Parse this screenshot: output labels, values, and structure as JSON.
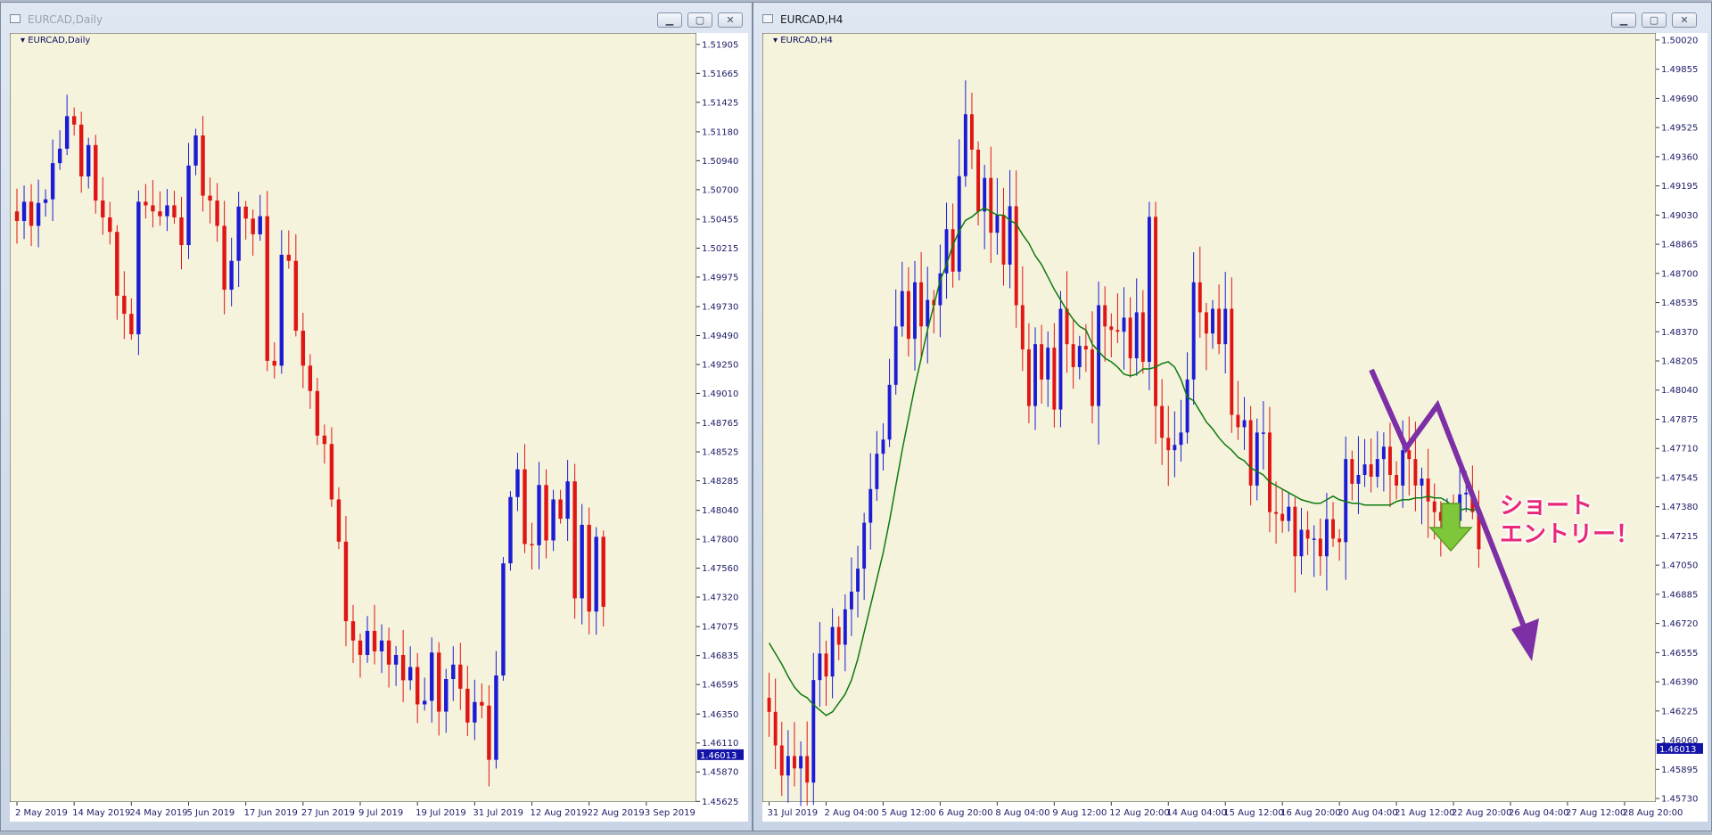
{
  "windows": {
    "left": {
      "title": "EURCAD,Daily",
      "minimize": "▁",
      "maximize": "▢",
      "close": "✕"
    },
    "right": {
      "title": "EURCAD,H4",
      "minimize": "▁",
      "maximize": "▢",
      "close": "✕"
    }
  },
  "colors": {
    "background": "#f5f3dc",
    "bull": "#1c1cd6",
    "bear": "#e01515",
    "ma": "#0e7a0e",
    "axis_text": "#1a1a66",
    "price_badge": "#1414a8",
    "arrow": "#7d2fa6",
    "entry_arrow": "#7ec63a",
    "annotation": "#e8267a"
  },
  "annotation": {
    "line1": "ショート",
    "line2": "エントリー！"
  },
  "chart_data": [
    {
      "name": "EURCAD,Daily",
      "type": "candlestick",
      "symbol_label": "EURCAD,Daily",
      "current_price": "1.46013",
      "ylim": [
        1.4562,
        1.52
      ],
      "y_ticks": [
        "1.51905",
        "1.51665",
        "1.51425",
        "1.51180",
        "1.50940",
        "1.50700",
        "1.50455",
        "1.50215",
        "1.49975",
        "1.49730",
        "1.49490",
        "1.49250",
        "1.49010",
        "1.48765",
        "1.48525",
        "1.48285",
        "1.48040",
        "1.47800",
        "1.47560",
        "1.47320",
        "1.47075",
        "1.46835",
        "1.46595",
        "1.46350",
        "1.46110",
        "1.45870",
        "1.45625"
      ],
      "x_labels": [
        {
          "label": "2 May 2019",
          "i": 0
        },
        {
          "label": "14 May 2019",
          "i": 8
        },
        {
          "label": "24 May 2019",
          "i": 16
        },
        {
          "label": "5 Jun 2019",
          "i": 24
        },
        {
          "label": "17 Jun 2019",
          "i": 32
        },
        {
          "label": "27 Jun 2019",
          "i": 40
        },
        {
          "label": "9 Jul 2019",
          "i": 48
        },
        {
          "label": "19 Jul 2019",
          "i": 56
        },
        {
          "label": "31 Jul 2019",
          "i": 64
        },
        {
          "label": "12 Aug 2019",
          "i": 72
        },
        {
          "label": "22 Aug 2019",
          "i": 80
        },
        {
          "label": "3 Sep 2019",
          "i": 88
        }
      ],
      "slots": 96,
      "closes": [
        1.5044,
        1.506,
        1.504,
        1.5059,
        1.5062,
        1.5092,
        1.5104,
        1.5131,
        1.5124,
        1.5081,
        1.5107,
        1.5061,
        1.5047,
        1.5035,
        1.4982,
        1.4967,
        1.495,
        1.506,
        1.5057,
        1.5052,
        1.5048,
        1.5057,
        1.5047,
        1.5024,
        1.509,
        1.5115,
        1.5065,
        1.5061,
        1.504,
        1.4987,
        1.5011,
        1.5056,
        1.5046,
        1.5033,
        1.5048,
        1.4928,
        1.4924,
        1.5016,
        1.5011,
        1.4953,
        1.4924,
        1.4903,
        1.4866,
        1.4859,
        1.4813,
        1.4778,
        1.4712,
        1.4696,
        1.4684,
        1.4704,
        1.4687,
        1.4696,
        1.4676,
        1.4684,
        1.4663,
        1.4674,
        1.4643,
        1.4646,
        1.4686,
        1.4637,
        1.4664,
        1.4676,
        1.4656,
        1.4628,
        1.4645,
        1.4642,
        1.4597,
        1.4667,
        1.476,
        1.4815,
        1.4838,
        1.4776,
        1.4775,
        1.4825,
        1.4779,
        1.4813,
        1.4797,
        1.4828,
        1.4731,
        1.4792,
        1.472,
        1.4782,
        1.4724
      ]
    },
    {
      "name": "EURCAD,H4",
      "type": "candlestick",
      "symbol_label": "EURCAD,H4",
      "current_price": "1.46013",
      "ylim": [
        1.4571,
        1.5006
      ],
      "y_ticks": [
        "1.50020",
        "1.49855",
        "1.49690",
        "1.49525",
        "1.49360",
        "1.49195",
        "1.49030",
        "1.48865",
        "1.48700",
        "1.48535",
        "1.48370",
        "1.48205",
        "1.48040",
        "1.47875",
        "1.47710",
        "1.47545",
        "1.47380",
        "1.47215",
        "1.47050",
        "1.46885",
        "1.46720",
        "1.46555",
        "1.46390",
        "1.46225",
        "1.46060",
        "1.45895",
        "1.45730"
      ],
      "x_labels": [
        {
          "label": "31 Jul 2019",
          "i": 0
        },
        {
          "label": "2 Aug 04:00",
          "i": 9
        },
        {
          "label": "5 Aug 12:00",
          "i": 18
        },
        {
          "label": "6 Aug 20:00",
          "i": 27
        },
        {
          "label": "8 Aug 04:00",
          "i": 36
        },
        {
          "label": "9 Aug 12:00",
          "i": 45
        },
        {
          "label": "12 Aug 20:00",
          "i": 54
        },
        {
          "label": "14 Aug 04:00",
          "i": 63
        },
        {
          "label": "15 Aug 12:00",
          "i": 72
        },
        {
          "label": "16 Aug 20:00",
          "i": 81
        },
        {
          "label": "20 Aug 04:00",
          "i": 90
        },
        {
          "label": "21 Aug 12:00",
          "i": 99
        },
        {
          "label": "22 Aug 20:00",
          "i": 108
        },
        {
          "label": "26 Aug 04:00",
          "i": 117
        },
        {
          "label": "27 Aug 12:00",
          "i": 126
        },
        {
          "label": "28 Aug 20:00",
          "i": 135
        }
      ],
      "slots": 141,
      "closes": [
        1.4622,
        1.4603,
        1.4586,
        1.4597,
        1.459,
        1.4597,
        1.4582,
        1.464,
        1.4655,
        1.4642,
        1.467,
        1.466,
        1.468,
        1.469,
        1.4703,
        1.4729,
        1.4748,
        1.4768,
        1.4776,
        1.4807,
        1.484,
        1.486,
        1.4833,
        1.4865,
        1.484,
        1.4855,
        1.4852,
        1.487,
        1.4895,
        1.4871,
        1.4925,
        1.496,
        1.494,
        1.4905,
        1.4924,
        1.4893,
        1.4903,
        1.4875,
        1.4908,
        1.4852,
        1.4827,
        1.4795,
        1.483,
        1.481,
        1.4828,
        1.4793,
        1.485,
        1.483,
        1.4817,
        1.4829,
        1.4827,
        1.4795,
        1.4852,
        1.484,
        1.4838,
        1.4837,
        1.4845,
        1.4822,
        1.4848,
        1.482,
        1.4902,
        1.4795,
        1.4777,
        1.477,
        1.4773,
        1.478,
        1.481,
        1.4865,
        1.4848,
        1.4836,
        1.485,
        1.483,
        1.485,
        1.479,
        1.4783,
        1.4787,
        1.475,
        1.478,
        1.478,
        1.4735,
        1.4734,
        1.473,
        1.4738,
        1.471,
        1.4725,
        1.472,
        1.472,
        1.471,
        1.4731,
        1.472,
        1.4718,
        1.4765,
        1.4751,
        1.4756,
        1.4762,
        1.4755,
        1.4765,
        1.4772,
        1.4756,
        1.475,
        1.477,
        1.4765,
        1.475,
        1.4754,
        1.4741,
        1.4735,
        1.473,
        1.4737,
        1.473,
        1.4745,
        1.4746,
        1.4735,
        1.4714
      ],
      "ma_closes": [
        1.4661,
        1.4655,
        1.4649,
        1.4642,
        1.4636,
        1.4632,
        1.463,
        1.4626,
        1.4623,
        1.462,
        1.4622,
        1.4627,
        1.4632,
        1.464,
        1.4652,
        1.4667,
        1.4682,
        1.4697,
        1.4712,
        1.473,
        1.475,
        1.477,
        1.4788,
        1.4806,
        1.4822,
        1.4838,
        1.4852,
        1.4866,
        1.4875,
        1.4886,
        1.4894,
        1.49,
        1.4902,
        1.4905,
        1.4907,
        1.4905,
        1.4903,
        1.4903,
        1.49,
        1.4898,
        1.4892,
        1.4887,
        1.488,
        1.4875,
        1.4868,
        1.4861,
        1.4855,
        1.4849,
        1.4844,
        1.484,
        1.4838,
        1.483,
        1.4826,
        1.4822,
        1.482,
        1.4817,
        1.4813,
        1.4812,
        1.4813,
        1.4816,
        1.4816,
        1.4817,
        1.4819,
        1.482,
        1.4817,
        1.481,
        1.48,
        1.4798,
        1.4792,
        1.4786,
        1.4782,
        1.4777,
        1.4773,
        1.477,
        1.4766,
        1.4764,
        1.476,
        1.4758,
        1.4756,
        1.4752,
        1.475,
        1.4748,
        1.4746,
        1.4744,
        1.4742,
        1.4741,
        1.474,
        1.474,
        1.4742,
        1.4744,
        1.4742,
        1.4741,
        1.474,
        1.474,
        1.4739,
        1.4739,
        1.4739,
        1.4739,
        1.4739,
        1.4741,
        1.4742,
        1.4742,
        1.4743,
        1.4743,
        1.4744,
        1.4743,
        1.4743,
        1.4741,
        1.4738,
        1.4736,
        1.4737,
        1.4736,
        1.4737
      ]
    }
  ]
}
